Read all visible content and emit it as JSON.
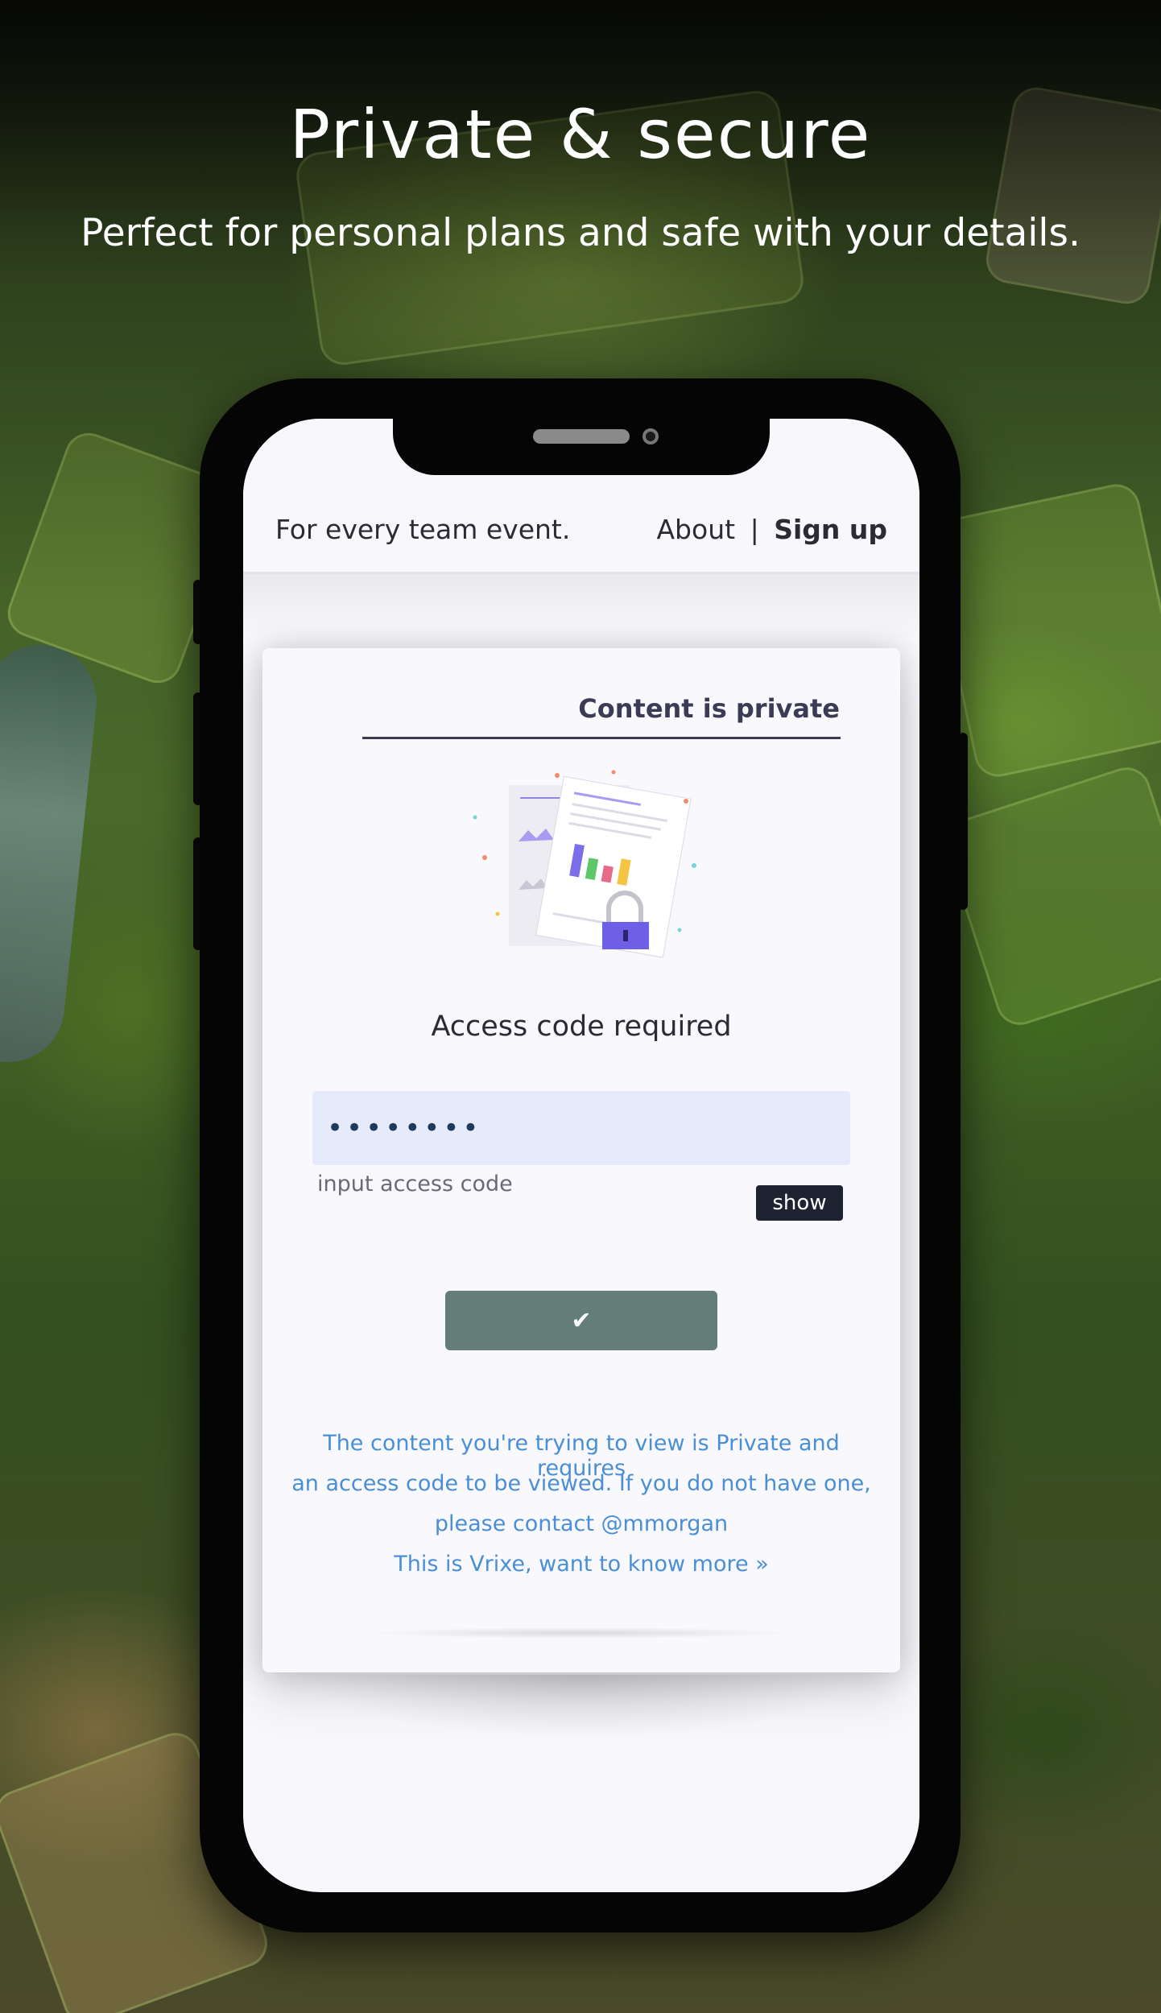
{
  "promo": {
    "title": "Private & secure",
    "subtitle": "Perfect for personal plans and safe with your details."
  },
  "app_header": {
    "tagline": "For every team event.",
    "about_label": "About",
    "separator": "|",
    "signup_label": "Sign up"
  },
  "card": {
    "tab_label": "Content is private",
    "access_title": "Access code required",
    "code_value": "••••••••",
    "input_hint": "input access code",
    "show_label": "show",
    "submit_icon": "check-icon",
    "info_line1": "The content you're trying to view is Private and requires",
    "info_line2": "an access code to be viewed. If you do not have one,",
    "info_line3": "please contact @mmorgan",
    "info_line4": "This is Vrixe, want to know more »"
  },
  "colors": {
    "submit_button": "#647d79",
    "input_background": "#e5ebfb",
    "info_text": "#4a8fd6",
    "show_button": "#1f2230"
  }
}
